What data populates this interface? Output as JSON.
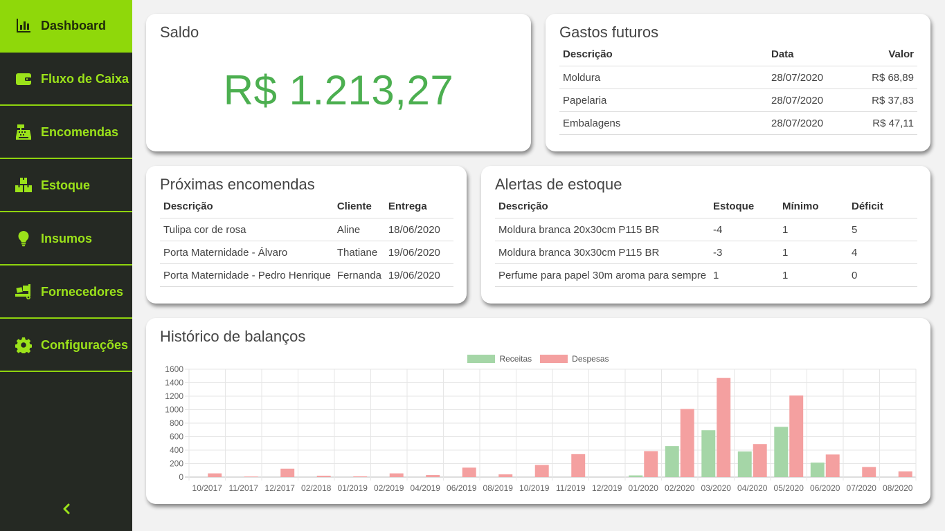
{
  "sidebar": {
    "items": [
      {
        "label": "Dashboard",
        "icon": "bar-chart-icon",
        "active": true
      },
      {
        "label": "Fluxo de Caixa",
        "icon": "wallet-icon"
      },
      {
        "label": "Encomendas",
        "icon": "cash-register-icon"
      },
      {
        "label": "Estoque",
        "icon": "boxes-icon"
      },
      {
        "label": "Insumos",
        "icon": "lightbulb-icon"
      },
      {
        "label": "Fornecedores",
        "icon": "truck-loading-icon"
      },
      {
        "label": "Configurações",
        "icon": "gear-icon"
      }
    ],
    "collapse_icon": "chevron-left-icon"
  },
  "colors": {
    "sidebar_bg": "#252923",
    "accent": "#8fd80a",
    "saldo": "#4caf50",
    "receitas": "#a5d6a7",
    "despesas": "#f4a0a0"
  },
  "saldo": {
    "title": "Saldo",
    "value": "R$ 1.213,27"
  },
  "gastos_futuros": {
    "title": "Gastos futuros",
    "columns": [
      "Descrição",
      "Data",
      "Valor"
    ],
    "rows": [
      [
        "Moldura",
        "28/07/2020",
        "R$ 68,89"
      ],
      [
        "Papelaria",
        "28/07/2020",
        "R$ 37,83"
      ],
      [
        "Embalagens",
        "28/07/2020",
        "R$ 47,11"
      ]
    ]
  },
  "proximas_encomendas": {
    "title": "Próximas encomendas",
    "columns": [
      "Descrição",
      "Cliente",
      "Entrega"
    ],
    "rows": [
      [
        "Tulipa cor de rosa",
        "Aline",
        "18/06/2020"
      ],
      [
        "Porta Maternidade - Álvaro",
        "Thatiane",
        "19/06/2020"
      ],
      [
        "Porta Maternidade - Pedro Henrique",
        "Fernanda",
        "19/06/2020"
      ]
    ]
  },
  "alertas_estoque": {
    "title": "Alertas de estoque",
    "columns": [
      "Descrição",
      "Estoque",
      "Mínimo",
      "Déficit"
    ],
    "rows": [
      [
        "Moldura branca 20x30cm P115 BR",
        "-4",
        "1",
        "5"
      ],
      [
        "Moldura branca 30x30cm P115 BR",
        "-3",
        "1",
        "4"
      ],
      [
        "Perfume para papel 30m aroma para sempre",
        "1",
        "1",
        "0"
      ]
    ]
  },
  "historico": {
    "title": "Histórico de balanços"
  },
  "chart_data": {
    "type": "bar",
    "categories": [
      "10/2017",
      "11/2017",
      "12/2017",
      "02/2018",
      "01/2019",
      "02/2019",
      "04/2019",
      "06/2019",
      "08/2019",
      "10/2019",
      "11/2019",
      "12/2019",
      "01/2020",
      "02/2020",
      "03/2020",
      "04/2020",
      "05/2020",
      "06/2020",
      "07/2020",
      "08/2020"
    ],
    "series": [
      {
        "name": "Receitas",
        "color": "#a5d6a7",
        "values": [
          0,
          0,
          0,
          0,
          0,
          0,
          0,
          0,
          0,
          0,
          0,
          0,
          25,
          460,
          695,
          380,
          745,
          215,
          0,
          0
        ]
      },
      {
        "name": "Despesas",
        "color": "#f4a0a0",
        "values": [
          55,
          8,
          125,
          20,
          10,
          55,
          30,
          140,
          40,
          180,
          340,
          0,
          385,
          1010,
          1470,
          490,
          1210,
          335,
          150,
          85
        ]
      }
    ],
    "ylim": [
      0,
      1600
    ],
    "yticks": [
      "1600",
      "1400",
      "1200",
      "1000",
      "800",
      "600",
      "400",
      "200",
      "0"
    ],
    "grid": true,
    "legend": "top-center"
  }
}
